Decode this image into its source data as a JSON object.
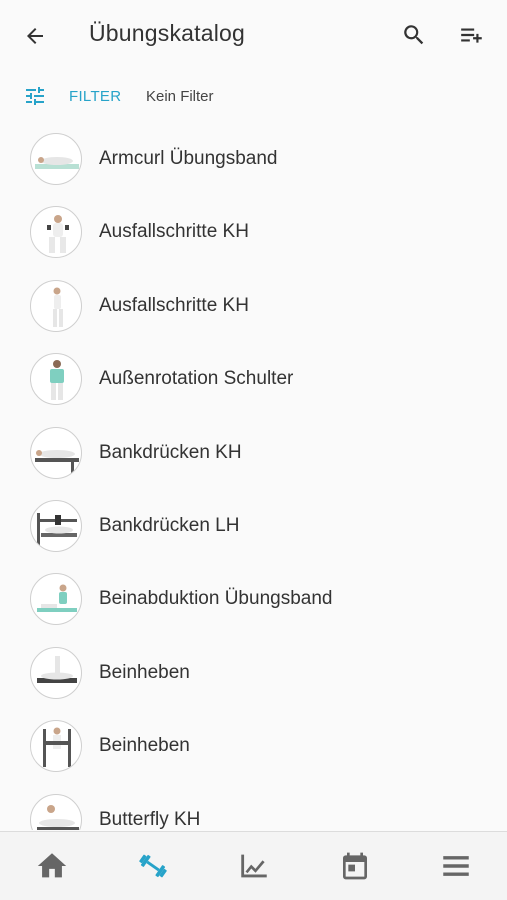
{
  "appbar": {
    "title": "Übungskatalog",
    "back_icon": "arrow-left-icon",
    "search_icon": "search-icon",
    "add_icon": "playlist-add-icon"
  },
  "filter": {
    "label": "FILTER",
    "value": "Kein Filter",
    "accent": "#27a3c9"
  },
  "exercises": [
    {
      "name": "Armcurl Übungsband"
    },
    {
      "name": "Ausfallschritte KH"
    },
    {
      "name": "Ausfallschritte KH"
    },
    {
      "name": "Außenrotation Schulter"
    },
    {
      "name": "Bankdrücken KH"
    },
    {
      "name": "Bankdrücken LH"
    },
    {
      "name": "Beinabduktion Übungsband"
    },
    {
      "name": "Beinheben"
    },
    {
      "name": "Beinheben"
    },
    {
      "name": "Butterfly KH"
    }
  ],
  "bottom_nav": {
    "items": [
      "home-icon",
      "dumbbell-icon",
      "chart-icon",
      "calendar-icon",
      "menu-icon"
    ],
    "active": "dumbbell-icon",
    "active_color": "#27a3c9",
    "inactive_color": "#666666"
  }
}
